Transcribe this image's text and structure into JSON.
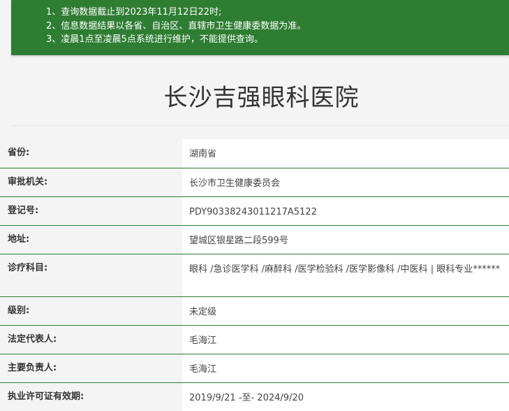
{
  "notice": {
    "lines": [
      "1、查询数据截止到2023年11月12日22时;",
      "2、信息数据结果以各省、自治区、直辖市卫生健康委数据为准。",
      "3、凌晨1点至凌晨5点系统进行维护，不能提供查询。"
    ]
  },
  "page": {
    "title": "长沙吉强眼科医院"
  },
  "rows": [
    {
      "label": "省份:",
      "value": "湖南省"
    },
    {
      "label": "审批机关:",
      "value": "长沙市卫生健康委员会"
    },
    {
      "label": "登记号:",
      "value": "PDY90338243011217A5122"
    },
    {
      "label": "地址:",
      "value": "望城区银星路二段599号"
    },
    {
      "label": "诊疗科目:",
      "value": "眼科 /急诊医学科 /麻醉科 /医学检验科 /医学影像科 /中医科  |  眼科专业******"
    },
    {
      "label": "级别:",
      "value": "未定级"
    },
    {
      "label": "法定代表人:",
      "value": "毛海江"
    },
    {
      "label": "主要负责人:",
      "value": "毛海江"
    },
    {
      "label": "执业许可证有效期:",
      "value": "2019/9/21 -至- 2024/9/20"
    }
  ],
  "colors": {
    "accent": "#2e7d32",
    "background": "#f4f4f4"
  }
}
